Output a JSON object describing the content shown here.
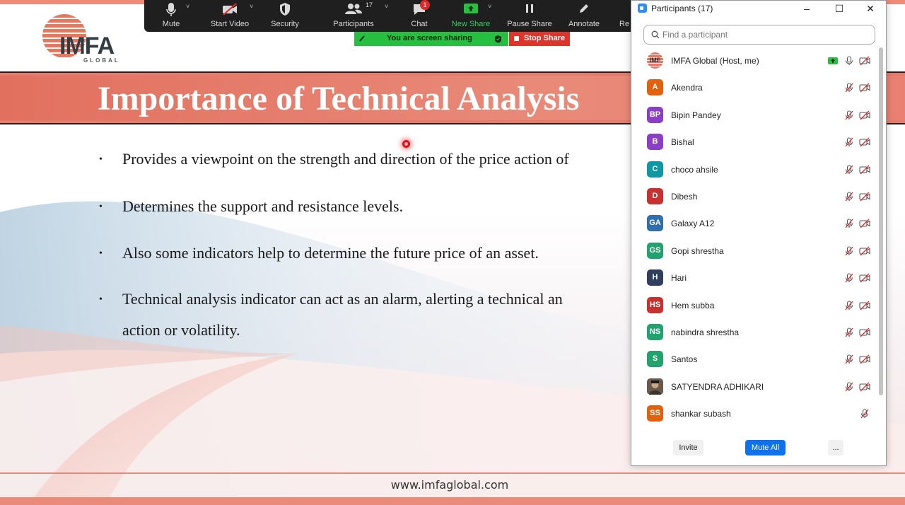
{
  "slide": {
    "logo_text": "IMFA",
    "logo_sub": "GLOBAL",
    "title": "Importance of Technical Analysis",
    "bullets": [
      "Provides a viewpoint on the strength and direction of the price action of",
      "Determines the support and resistance levels.",
      "Also some indicators help to determine the future price of an asset.",
      "Technical analysis indicator can act as an alarm, alerting a technical an"
    ],
    "bullet_continuation": "action or volatility.",
    "footer_url": "www.imfaglobal.com",
    "bullet_glyph": "•"
  },
  "toolbar": {
    "items": [
      {
        "label": "Mute",
        "icon": "microphone-icon"
      },
      {
        "label": "Start Video",
        "icon": "video-off-icon"
      },
      {
        "label": "Security",
        "icon": "shield-icon"
      },
      {
        "label": "Participants",
        "icon": "participants-icon",
        "count": "17"
      },
      {
        "label": "Chat",
        "icon": "chat-icon",
        "badge": "1"
      },
      {
        "label": "New Share",
        "icon": "share-screen-icon"
      },
      {
        "label": "Pause Share",
        "icon": "pause-icon"
      },
      {
        "label": "Annotate",
        "icon": "pencil-icon"
      },
      {
        "label": "Re",
        "icon": "remote-control-icon"
      }
    ],
    "sharing_banner": "You are screen sharing",
    "stop_share": "Stop Share"
  },
  "panel": {
    "title": "Participants (17)",
    "search_placeholder": "Find a participant",
    "participants": [
      {
        "initials": "IMF",
        "name": "IMFA Global (Host, me)",
        "color": "#f6d3cc"
      },
      {
        "initials": "A",
        "name": "Akendra",
        "color": "#e0620e"
      },
      {
        "initials": "BP",
        "name": "Bipin Pandey",
        "color": "#8a3fc6"
      },
      {
        "initials": "B",
        "name": "Bishal",
        "color": "#8a3fc6"
      },
      {
        "initials": "C",
        "name": "choco ahsile",
        "color": "#0d98a4"
      },
      {
        "initials": "D",
        "name": "Dibesh",
        "color": "#c8312e"
      },
      {
        "initials": "GA",
        "name": "Galaxy A12",
        "color": "#2f6fb0"
      },
      {
        "initials": "GS",
        "name": "Gopi shrestha",
        "color": "#22a26f"
      },
      {
        "initials": "H",
        "name": "Hari",
        "color": "#2f3f5d"
      },
      {
        "initials": "HS",
        "name": "Hem subba",
        "color": "#c8312e"
      },
      {
        "initials": "NS",
        "name": "nabindra shrestha",
        "color": "#22a26f"
      },
      {
        "initials": "S",
        "name": "Santos",
        "color": "#22a26f"
      },
      {
        "initials": "",
        "name": "SATYENDRA ADHIKARI",
        "color": "#6b5a4a"
      },
      {
        "initials": "SS",
        "name": "shankar subash",
        "color": "#e0620e"
      }
    ],
    "buttons": {
      "invite": "Invite",
      "mute_all": "Mute All",
      "more": "..."
    },
    "window_controls": {
      "minimize": "–",
      "maximize": "☐",
      "close": "✕"
    }
  },
  "colors": {
    "accent_blue": "#0e72ed",
    "share_green": "#25c03f",
    "stop_red": "#e2332b",
    "slide_band": "#e57b6b"
  }
}
